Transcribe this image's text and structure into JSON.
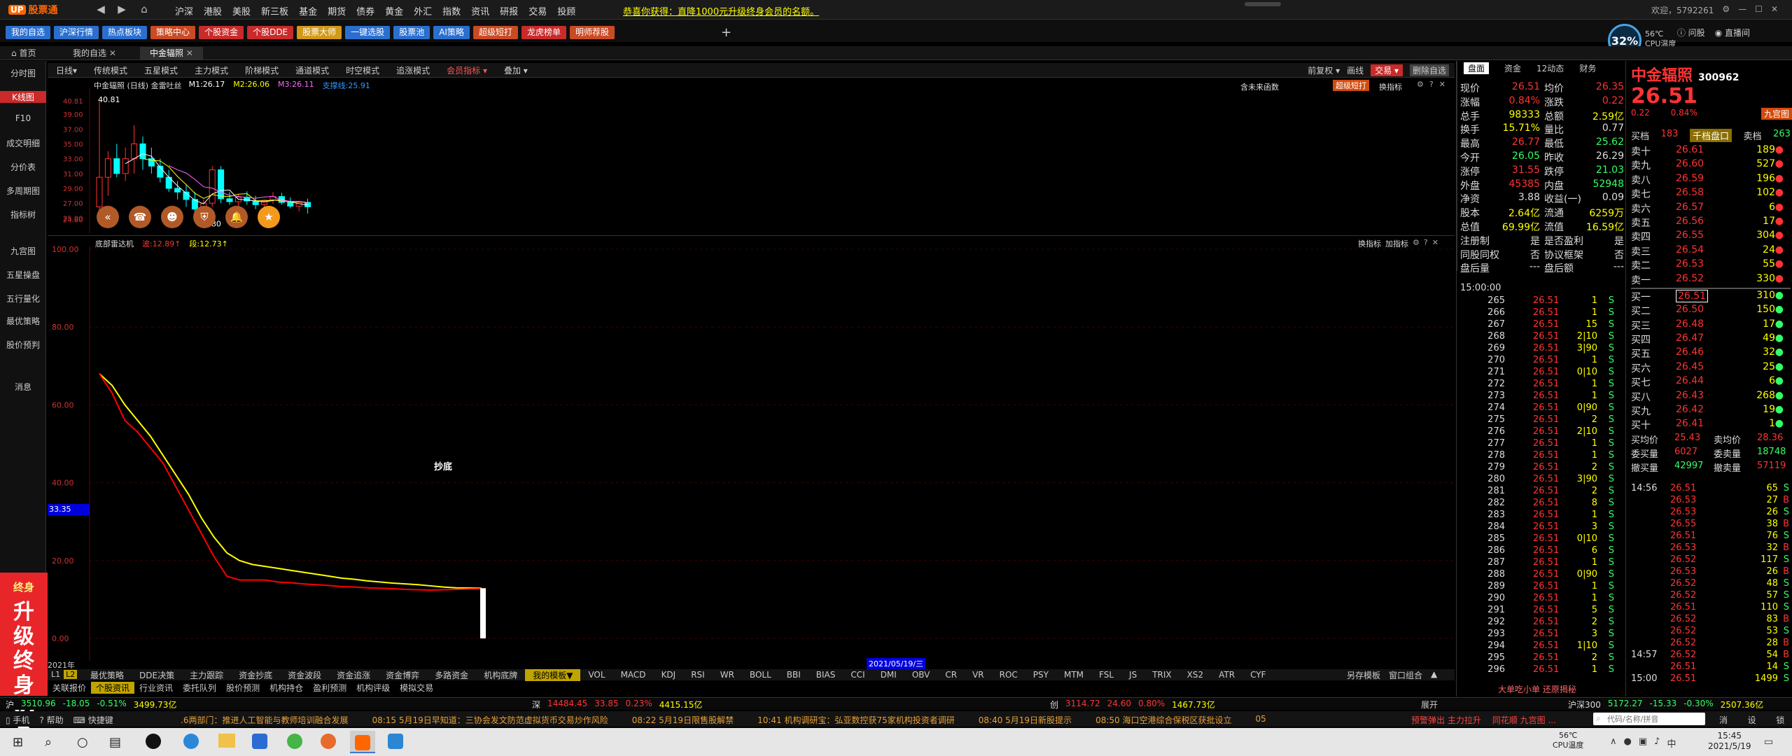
{
  "window": {
    "app_name": "股票通",
    "menu": [
      "沪深",
      "港股",
      "美股",
      "新三板",
      "基金",
      "期货",
      "债券",
      "黄金",
      "外汇",
      "指数",
      "资讯",
      "研报",
      "交易",
      "投顾"
    ],
    "promo": "恭喜你获得：直降1000元升级终身会员的名额。",
    "user": "欢迎，5792261",
    "right_tools": [
      "问股",
      "直播间"
    ],
    "cpu": {
      "pct": "32%",
      "temp": "56℃",
      "label": "CPU温度"
    }
  },
  "quickbar": {
    "buttons": [
      {
        "label": "我的自选",
        "color": "#2a6fcf"
      },
      {
        "label": "沪深行情",
        "color": "#2a6fcf"
      },
      {
        "label": "热点板块",
        "color": "#2a6fcf"
      },
      {
        "label": "策略中心",
        "color": "#c94a24"
      },
      {
        "label": "个股资金",
        "color": "#c92a2a"
      },
      {
        "label": "个股DDE",
        "color": "#c92a2a"
      },
      {
        "label": "股票大师",
        "color": "#d29a1a"
      },
      {
        "label": "一键选股",
        "color": "#2a6fcf"
      },
      {
        "label": "股票池",
        "color": "#2a6fcf"
      },
      {
        "label": "AI策略",
        "color": "#2a6fcf"
      },
      {
        "label": "超级短打",
        "color": "#c94a24"
      },
      {
        "label": "龙虎榜单",
        "color": "#c92a2a"
      },
      {
        "label": "明师荐股",
        "color": "#c94a24"
      }
    ],
    "add": "+"
  },
  "tabs": [
    {
      "label": "首页"
    },
    {
      "label": "我的自选"
    },
    {
      "label": "中金辐照"
    }
  ],
  "left_tools": [
    {
      "label": "分时图"
    },
    {
      "label": "K线图"
    },
    {
      "label": "F10"
    },
    {
      "label": "成交明细"
    },
    {
      "label": "分价表"
    },
    {
      "label": "多周期图"
    },
    {
      "label": "指标树"
    },
    {
      "label": "九宫图"
    },
    {
      "label": "五星操盘"
    },
    {
      "label": "五行量化"
    },
    {
      "label": "最优策略"
    },
    {
      "label": "股价预判"
    },
    {
      "label": "消息"
    }
  ],
  "vip": {
    "text": "升级终身VIP",
    "badge": "终身"
  },
  "chart_toolbar": {
    "items": [
      "日线▾",
      "传统模式",
      "五星模式",
      "主力模式",
      "阶梯模式",
      "通道模式",
      "时空模式",
      "追涨模式",
      "会员指标 ▾",
      "叠加 ▾"
    ],
    "right": [
      "前复权 ▾",
      "画线",
      "交易 ▾",
      "删除自选"
    ]
  },
  "kline_panel": {
    "title": "中金辐照 (日线) 金雷吐丝",
    "ma": [
      {
        "name": "M1:26.17",
        "color": "#ffffff"
      },
      {
        "name": "M2:26.06",
        "color": "#ffff00"
      },
      {
        "name": "M3:26.11",
        "color": "#ff66ff"
      },
      {
        "name": "支撑线:25.91",
        "color": "#3399ff"
      }
    ],
    "right_text": "含未来函数",
    "super_btn": "超级短打",
    "change_indicator": "换指标",
    "price_labels": [
      "40.81",
      "24.80"
    ],
    "y_ticks": [
      "40.81",
      "39.00",
      "37.00",
      "35.00",
      "33.00",
      "31.00",
      "29.00",
      "27.00",
      "25.00",
      "24.80"
    ]
  },
  "indicator_panel": {
    "title": "底部雷达机",
    "v1": "波:12.89↑",
    "v2": "段:12.73↑",
    "btns": [
      "换指标",
      "加指标"
    ],
    "label": "抄底",
    "y_ticks": [
      "100.00",
      "80.00",
      "60.00",
      "40.00",
      "20.00",
      "0.00"
    ],
    "cross_value": "33.35",
    "date_label": "2021/05/19/三",
    "year_label": "2021年"
  },
  "chart_data": [
    {
      "type": "line",
      "title": "底部雷达机",
      "series": [
        {
          "name": "波",
          "color": "#ffff00",
          "values": [
            68,
            65,
            60,
            56,
            52,
            47,
            42,
            37,
            31,
            26,
            22,
            20,
            19,
            18.5,
            18,
            17.5,
            17,
            16.5,
            16,
            15.5,
            15.2,
            14.8,
            14.5,
            14.2,
            14,
            13.8,
            13.5,
            13.2,
            13,
            12.95,
            12.89
          ]
        },
        {
          "name": "段",
          "color": "#ff0000",
          "values": [
            68,
            63,
            56,
            53,
            49,
            45,
            39,
            33,
            27,
            21,
            16,
            15,
            15,
            15,
            14.5,
            14.3,
            14,
            13.8,
            13.6,
            13.3,
            13.2,
            13,
            12.9,
            12.8,
            12.6,
            12.5,
            12.4,
            12.5,
            12.6,
            12.7,
            12.73
          ]
        }
      ],
      "ylim": [
        0,
        100
      ]
    },
    {
      "type": "bar",
      "title": "中金辐照 (日线) 金雷吐丝",
      "series": [
        {
          "name": "candles",
          "values": [
            [
              26.5,
              40.81,
              25.5,
              30.5
            ],
            [
              30.5,
              34,
              28,
              33
            ],
            [
              33,
              35,
              30.5,
              31
            ],
            [
              31,
              34.5,
              30,
              33
            ],
            [
              33,
              37.5,
              31,
              35
            ],
            [
              35,
              36,
              31.5,
              33
            ],
            [
              33,
              34.5,
              31,
              32
            ],
            [
              32,
              33,
              29.8,
              30.5
            ],
            [
              30.5,
              31.5,
              28.5,
              29
            ],
            [
              29,
              30,
              27.5,
              28.5
            ],
            [
              28.5,
              29.5,
              26.5,
              27.5
            ],
            [
              27.5,
              28.5,
              24.8,
              26.2
            ],
            [
              26.2,
              27.5,
              25.5,
              27
            ],
            [
              27,
              32,
              26.5,
              31.5
            ],
            [
              31.5,
              32,
              27,
              27.6
            ],
            [
              27.6,
              28.5,
              26.8,
              27.2
            ],
            [
              27.2,
              28.2,
              26.5,
              27.8
            ],
            [
              27.8,
              28.6,
              26.8,
              27.3
            ],
            [
              27.3,
              28,
              26.2,
              26.8
            ],
            [
              26.8,
              27.5,
              26,
              27.4
            ],
            [
              27.4,
              28.5,
              26.9,
              27.9
            ],
            [
              27.9,
              28.4,
              26.8,
              27.1
            ],
            [
              27.1,
              27.8,
              26.3,
              26.6
            ],
            [
              26.6,
              27.3,
              25.9,
              27.1
            ],
            [
              27.1,
              27.6,
              25.6,
              26.51
            ]
          ]
        }
      ],
      "ylim": [
        24,
        41
      ]
    }
  ],
  "bottom_tabs": [
    {
      "label": "最优策略"
    },
    {
      "label": "DDE决策"
    },
    {
      "label": "主力跟踪"
    },
    {
      "label": "资金抄底"
    },
    {
      "label": "资金波段"
    },
    {
      "label": "资金追涨"
    },
    {
      "label": "资金博弈"
    },
    {
      "label": "多路资金"
    },
    {
      "label": "机构底牌"
    },
    {
      "label": "我的模板▼",
      "sel": true
    },
    {
      "label": "VOL"
    },
    {
      "label": "MACD"
    },
    {
      "label": "KDJ"
    },
    {
      "label": "RSI"
    },
    {
      "label": "WR"
    },
    {
      "label": "BOLL"
    },
    {
      "label": "BBI"
    },
    {
      "label": "BIAS"
    },
    {
      "label": "CCI"
    },
    {
      "label": "DMI"
    },
    {
      "label": "OBV"
    },
    {
      "label": "CR"
    },
    {
      "label": "VR"
    },
    {
      "label": "ROC"
    },
    {
      "label": "PSY"
    },
    {
      "label": "MTM"
    },
    {
      "label": "FSL"
    },
    {
      "label": "JS"
    },
    {
      "label": "TRIX"
    },
    {
      "label": "XS2"
    },
    {
      "label": "ATR"
    },
    {
      "label": "CYF"
    }
  ],
  "bottom_tabs_right": [
    "另存模板",
    "窗口组合"
  ],
  "bottom_tabs2": [
    {
      "label": "关联报价"
    },
    {
      "label": "个股资讯",
      "sel": true
    },
    {
      "label": "行业资讯"
    },
    {
      "label": "委托队列"
    },
    {
      "label": "股价预测"
    },
    {
      "label": "机构持仓"
    },
    {
      "label": "盈利预测"
    },
    {
      "label": "机构评级"
    },
    {
      "label": "模拟交易"
    }
  ],
  "level_tabs": [
    "L1",
    "L2"
  ],
  "status": {
    "sh": {
      "name": "沪",
      "val": "3510.96",
      "chg": "-18.05",
      "pct": "-0.51%",
      "amt": "3499.73亿"
    },
    "sz": {
      "name": "深",
      "val": "14484.45",
      "chg": "33.85",
      "pct": "0.23%",
      "amt": "4415.15亿"
    },
    "cy": {
      "name": "创",
      "val": "3114.72",
      "chg": "24.60",
      "pct": "0.80%",
      "amt": "1467.73亿"
    },
    "hs300": {
      "name": "沪深300",
      "val": "5172.27",
      "chg": "-15.33",
      "pct": "-0.30%",
      "amt": "2507.36亿"
    },
    "expand": "展开"
  },
  "news": {
    "items": [
      ".6两部门：推进人工智能与教师培训融合发展",
      "08:15 5月19日早知道：三协会发文防范虚拟货币交易炒作风险",
      "08:22 5月19日限售股解禁",
      "10:41 机构调研宝：弘亚数控获75家机构投资者调研",
      "08:40 5月19日新股提示",
      "08:50 海口空港综合保税区获批设立",
      "05"
    ],
    "left": [
      "手机",
      "帮助",
      "快捷键"
    ],
    "right": [
      "预警弹出 主力拉升",
      "同花顺 九宫图 ..."
    ],
    "search_placeholder": "代码/名称/拼音",
    "right2": [
      "消息",
      "设置",
      "锁定"
    ]
  },
  "quote": {
    "tabs": [
      "盘面",
      "资金",
      "12动态",
      "财务"
    ],
    "name": "中金辐照",
    "code": "300962",
    "price": "26.51",
    "chg": "0.22",
    "pct": "0.84%",
    "nine": "九宫图",
    "fields_left": [
      [
        "现价",
        "26.51",
        "red"
      ],
      [
        "涨幅",
        "0.84%",
        "red"
      ],
      [
        "总手",
        "98333",
        "yellow"
      ],
      [
        "换手",
        "15.71%",
        "yellow"
      ],
      [
        "最高",
        "26.77",
        "red"
      ],
      [
        "今开",
        "26.05",
        "green"
      ],
      [
        "涨停",
        "31.55",
        "red"
      ],
      [
        "外盘",
        "45385",
        "red"
      ],
      [
        "净资",
        "3.88",
        "white"
      ],
      [
        "股本",
        "2.64亿",
        "yellow"
      ],
      [
        "总值",
        "69.99亿",
        "yellow"
      ],
      [
        "注册制",
        "是",
        "white"
      ],
      [
        "同股同权",
        "否",
        "white"
      ],
      [
        "盘后量",
        "---",
        "white"
      ]
    ],
    "fields_right": [
      [
        "均价",
        "26.35",
        "red"
      ],
      [
        "涨跌",
        "0.22",
        "red"
      ],
      [
        "总额",
        "2.59亿",
        "yellow"
      ],
      [
        "量比",
        "0.77",
        "white"
      ],
      [
        "最低",
        "25.62",
        "green"
      ],
      [
        "昨收",
        "26.29",
        "white"
      ],
      [
        "跌停",
        "21.03",
        "green"
      ],
      [
        "内盘",
        "52948",
        "green"
      ],
      [
        "收益(一)",
        "0.09",
        "white"
      ],
      [
        "流通",
        "6259万",
        "yellow"
      ],
      [
        "流值",
        "16.59亿",
        "yellow"
      ],
      [
        "是否盈利",
        "是",
        "white"
      ],
      [
        "协议框架",
        "否",
        "white"
      ],
      [
        "盘后额",
        "---",
        "white"
      ]
    ],
    "orderbook_header": {
      "buy": "买档",
      "buy_count": "183",
      "mid": "千档盘口",
      "sell": "卖档",
      "sell_count": "263"
    },
    "asks": [
      [
        "卖十",
        "26.61",
        "189"
      ],
      [
        "卖九",
        "26.60",
        "527"
      ],
      [
        "卖八",
        "26.59",
        "196"
      ],
      [
        "卖七",
        "26.58",
        "102"
      ],
      [
        "卖六",
        "26.57",
        "6"
      ],
      [
        "卖五",
        "26.56",
        "17"
      ],
      [
        "卖四",
        "26.55",
        "304"
      ],
      [
        "卖三",
        "26.54",
        "24"
      ],
      [
        "卖二",
        "26.53",
        "55"
      ],
      [
        "卖一",
        "26.52",
        "330"
      ]
    ],
    "bids": [
      [
        "买一",
        "26.51",
        "310"
      ],
      [
        "买二",
        "26.50",
        "150"
      ],
      [
        "买三",
        "26.48",
        "17"
      ],
      [
        "买四",
        "26.47",
        "49"
      ],
      [
        "买五",
        "26.46",
        "32"
      ],
      [
        "买六",
        "26.45",
        "25"
      ],
      [
        "买七",
        "26.44",
        "6"
      ],
      [
        "买八",
        "26.43",
        "268"
      ],
      [
        "买九",
        "26.42",
        "19"
      ],
      [
        "买十",
        "26.41",
        "1"
      ]
    ],
    "avg": {
      "buy_avg_l": "买均价",
      "buy_avg": "25.43",
      "sell_avg_l": "卖均价",
      "sell_avg": "28.36",
      "wb_l": "委买量",
      "wb": "6027",
      "ws_l": "委卖量",
      "ws": "18748",
      "cb_l": "撤买量",
      "cb": "42997",
      "cs_l": "撤卖量",
      "cs": "57119"
    }
  },
  "ticks": {
    "time": "15:00:00",
    "rows": [
      [
        "265",
        "26.51",
        "1",
        "S"
      ],
      [
        "266",
        "26.51",
        "1",
        "S"
      ],
      [
        "267",
        "26.51",
        "15",
        "S"
      ],
      [
        "268",
        "26.51",
        "2|10",
        "S"
      ],
      [
        "269",
        "26.51",
        "3|90",
        "S"
      ],
      [
        "270",
        "26.51",
        "1",
        "S"
      ],
      [
        "271",
        "26.51",
        "0|10",
        "S"
      ],
      [
        "272",
        "26.51",
        "1",
        "S"
      ],
      [
        "273",
        "26.51",
        "1",
        "S"
      ],
      [
        "274",
        "26.51",
        "0|90",
        "S"
      ],
      [
        "275",
        "26.51",
        "2",
        "S"
      ],
      [
        "276",
        "26.51",
        "2|10",
        "S"
      ],
      [
        "277",
        "26.51",
        "1",
        "S"
      ],
      [
        "278",
        "26.51",
        "1",
        "S"
      ],
      [
        "279",
        "26.51",
        "2",
        "S"
      ],
      [
        "280",
        "26.51",
        "3|90",
        "S"
      ],
      [
        "281",
        "26.51",
        "2",
        "S"
      ],
      [
        "282",
        "26.51",
        "8",
        "S"
      ],
      [
        "283",
        "26.51",
        "1",
        "S"
      ],
      [
        "284",
        "26.51",
        "3",
        "S"
      ],
      [
        "285",
        "26.51",
        "0|10",
        "S"
      ],
      [
        "286",
        "26.51",
        "6",
        "S"
      ],
      [
        "287",
        "26.51",
        "1",
        "S"
      ],
      [
        "288",
        "26.51",
        "0|90",
        "S"
      ],
      [
        "289",
        "26.51",
        "1",
        "S"
      ],
      [
        "290",
        "26.51",
        "1",
        "S"
      ],
      [
        "291",
        "26.51",
        "5",
        "S"
      ],
      [
        "292",
        "26.51",
        "2",
        "S"
      ],
      [
        "293",
        "26.51",
        "3",
        "S"
      ],
      [
        "294",
        "26.51",
        "1|10",
        "S"
      ],
      [
        "295",
        "26.51",
        "2",
        "S"
      ],
      [
        "296",
        "26.51",
        "1",
        "S"
      ]
    ],
    "footer": "大单吃小单 还原揭秘"
  },
  "ticks2": {
    "time1": "14:56",
    "time2": "14:57",
    "time3": "15:00",
    "rows": [
      [
        "26.51",
        "65",
        "S"
      ],
      [
        "26.53",
        "27",
        "B"
      ],
      [
        "26.53",
        "26",
        "S"
      ],
      [
        "26.55",
        "38",
        "B"
      ],
      [
        "26.51",
        "76",
        "S"
      ],
      [
        "26.53",
        "32",
        "B"
      ],
      [
        "26.52",
        "117",
        "S"
      ],
      [
        "26.53",
        "26",
        "B"
      ],
      [
        "26.52",
        "48",
        "S"
      ],
      [
        "26.52",
        "57",
        "S"
      ],
      [
        "26.51",
        "110",
        "S"
      ],
      [
        "26.52",
        "83",
        "B"
      ],
      [
        "26.52",
        "53",
        "S"
      ],
      [
        "26.52",
        "28",
        "B"
      ],
      [
        "26.52",
        "54",
        "B"
      ],
      [
        "26.51",
        "14",
        "S"
      ],
      [
        "26.51",
        "1499",
        "S"
      ]
    ]
  },
  "taskbar": {
    "temp": "56℃",
    "temp_label": "CPU温度",
    "time": "15:45",
    "date": "2021/5/19"
  }
}
